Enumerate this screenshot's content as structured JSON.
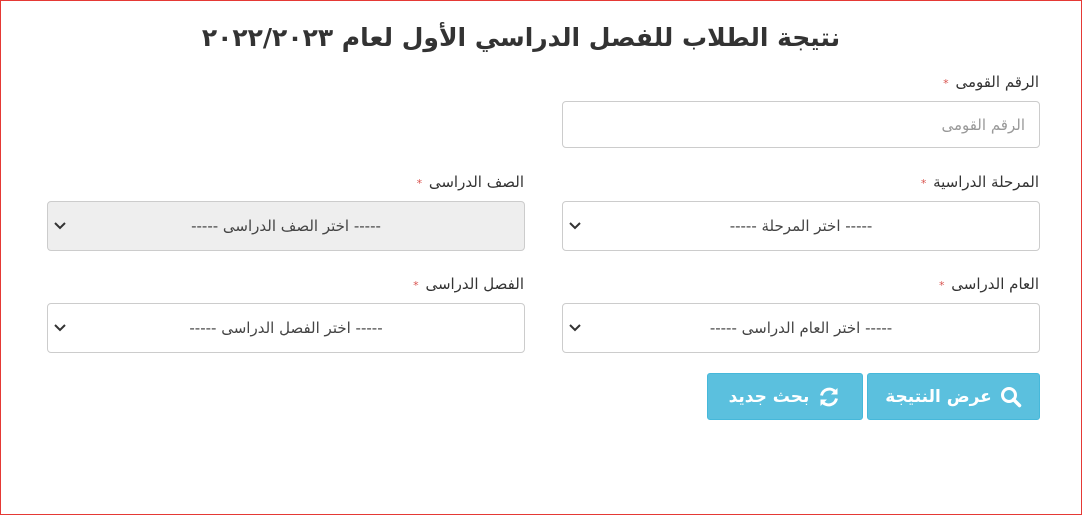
{
  "form": {
    "title": "نتيجة الطلاب للفصل الدراسي الأول لعام ٢٠٢٢/٢٠٢٣",
    "required_mark": "*",
    "national_id": {
      "label": "الرقم القومى",
      "placeholder": "الرقم القومى",
      "value": ""
    },
    "stage": {
      "label": "المرحلة الدراسية",
      "selected": "----- اختر المرحلة -----"
    },
    "grade": {
      "label": "الصف الدراسى",
      "selected": "----- اختر الصف الدراسى -----"
    },
    "year": {
      "label": "العام الدراسى",
      "selected": "----- اختر العام الدراسى -----"
    },
    "term": {
      "label": "الفصل الدراسى",
      "selected": "----- اختر الفصل الدراسى -----"
    }
  },
  "buttons": {
    "show_result": {
      "label": "عرض النتيجة",
      "icon": "search-icon"
    },
    "new_search": {
      "label": "بحث جديد",
      "icon": "refresh-icon"
    }
  },
  "colors": {
    "button_bg": "#5bc0de",
    "border": "#e53935",
    "required": "#d9534f"
  }
}
